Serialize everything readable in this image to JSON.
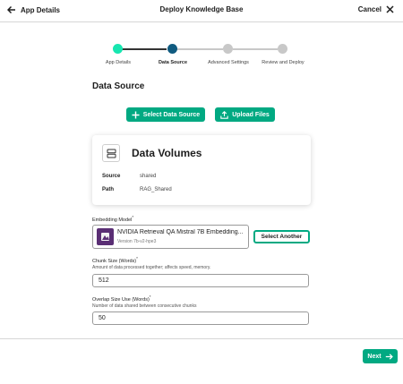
{
  "header": {
    "back_label": "App Details",
    "title": "Deploy Knowledge Base",
    "cancel_label": "Cancel"
  },
  "stepper": {
    "steps": [
      {
        "label": "App Details",
        "status": "complete"
      },
      {
        "label": "Data Source",
        "status": "active"
      },
      {
        "label": "Advanced Settings",
        "status": "upcoming"
      },
      {
        "label": "Review and Deploy",
        "status": "upcoming"
      }
    ]
  },
  "section_title": "Data Source",
  "actions": {
    "select_data_source": "Select Data Source",
    "upload_files": "Upload Files"
  },
  "data_card": {
    "title": "Data Volumes",
    "source_key": "Source",
    "source_value": "shared",
    "path_key": "Path",
    "path_value": "RAG_Shared"
  },
  "embedding": {
    "label": "Embedding Model",
    "required_mark": "*",
    "model_name": "NVIDIA Retrieval QA Mistral 7B Embedding...",
    "model_version": "Version 7b-v2-hpe3",
    "select_another": "Select Another"
  },
  "chunk_size": {
    "label": "Chunk Size (Words)",
    "required_mark": "*",
    "help": "Amount of data processed together; affects speed, memory.",
    "value": "512"
  },
  "overlap": {
    "label": "Overlap Size Use (Words)",
    "required_mark": "*",
    "help": "Number of data shared between consecutive chunks",
    "value": "50"
  },
  "footer": {
    "next_label": "Next"
  },
  "colors": {
    "accent": "#01a982",
    "step_active": "#105b80",
    "step_upcoming": "#c8c8c8",
    "line_complete": "#333333"
  }
}
